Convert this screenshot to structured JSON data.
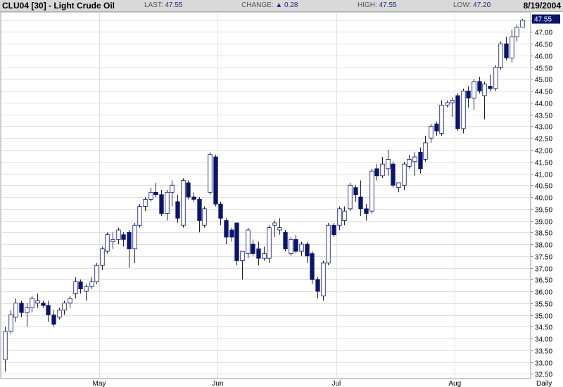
{
  "header": {
    "symbol": "CLU04 [30] - Light Crude Oil",
    "last_label": "LAST:",
    "last_value": "47.55",
    "change_label": "CHANGE:",
    "change_arrow": "▲",
    "change_value": "0.28",
    "high_label": "HIGH:",
    "high_value": "47.55",
    "low_label": "LOW:",
    "low_value": "47.20",
    "date": "8/19/2004"
  },
  "colors": {
    "up_fill": "#ffffff",
    "down_fill": "#0a146e",
    "candle_outline": "#0a146e",
    "grid": "#e0e0e0",
    "header_bg": "#d9d9d9",
    "badge_bg": "#0a146e"
  },
  "chart_data": {
    "type": "candlestick",
    "period_label": "Daily",
    "last_price_label": "47.55",
    "y_ticks": [
      "32.50",
      "33.00",
      "33.50",
      "34.00",
      "34.50",
      "35.00",
      "35.50",
      "36.00",
      "36.50",
      "37.00",
      "37.50",
      "38.00",
      "38.50",
      "39.00",
      "39.50",
      "40.00",
      "40.50",
      "41.00",
      "41.50",
      "42.00",
      "42.50",
      "43.00",
      "43.50",
      "44.00",
      "44.50",
      "45.00",
      "45.50",
      "46.00",
      "46.50",
      "47.00",
      "47.50"
    ],
    "ylim": [
      32.3,
      47.85
    ],
    "x_labels": [
      {
        "label": "May",
        "index": 17.5
      },
      {
        "label": "Jun",
        "index": 39.5
      },
      {
        "label": "Jul",
        "index": 61.5
      },
      {
        "label": "Aug",
        "index": 83.5
      }
    ],
    "x_gridlines": [
      17.5,
      39.5,
      61.5,
      83.5
    ],
    "candles": [
      {
        "o": 33.1,
        "h": 34.5,
        "l": 32.6,
        "c": 34.3
      },
      {
        "o": 34.3,
        "h": 35.2,
        "l": 34.2,
        "c": 35.0
      },
      {
        "o": 34.9,
        "h": 35.7,
        "l": 34.7,
        "c": 35.5
      },
      {
        "o": 35.5,
        "h": 35.6,
        "l": 34.9,
        "c": 35.1
      },
      {
        "o": 35.1,
        "h": 35.5,
        "l": 34.5,
        "c": 35.3
      },
      {
        "o": 35.3,
        "h": 35.8,
        "l": 35.1,
        "c": 35.7
      },
      {
        "o": 35.5,
        "h": 35.9,
        "l": 35.3,
        "c": 35.6
      },
      {
        "o": 35.5,
        "h": 35.6,
        "l": 35.3,
        "c": 35.4
      },
      {
        "o": 35.4,
        "h": 35.6,
        "l": 34.7,
        "c": 35.0
      },
      {
        "o": 35.0,
        "h": 35.2,
        "l": 34.5,
        "c": 34.6
      },
      {
        "o": 34.9,
        "h": 35.3,
        "l": 34.8,
        "c": 35.2
      },
      {
        "o": 35.2,
        "h": 35.6,
        "l": 35.0,
        "c": 35.5
      },
      {
        "o": 35.5,
        "h": 35.8,
        "l": 35.3,
        "c": 35.7
      },
      {
        "o": 35.9,
        "h": 36.6,
        "l": 35.7,
        "c": 36.4
      },
      {
        "o": 36.4,
        "h": 36.5,
        "l": 35.9,
        "c": 36.1
      },
      {
        "o": 36.0,
        "h": 36.3,
        "l": 35.6,
        "c": 36.2
      },
      {
        "o": 36.2,
        "h": 36.6,
        "l": 36.1,
        "c": 36.4
      },
      {
        "o": 36.4,
        "h": 37.2,
        "l": 36.3,
        "c": 37.1
      },
      {
        "o": 37.1,
        "h": 37.9,
        "l": 36.9,
        "c": 37.8
      },
      {
        "o": 37.7,
        "h": 38.5,
        "l": 37.6,
        "c": 38.4
      },
      {
        "o": 38.1,
        "h": 38.5,
        "l": 37.8,
        "c": 38.2
      },
      {
        "o": 38.2,
        "h": 38.7,
        "l": 38.0,
        "c": 38.6
      },
      {
        "o": 38.4,
        "h": 38.5,
        "l": 37.9,
        "c": 38.2
      },
      {
        "o": 38.5,
        "h": 38.6,
        "l": 37.0,
        "c": 37.8
      },
      {
        "o": 37.8,
        "h": 38.9,
        "l": 37.2,
        "c": 38.8
      },
      {
        "o": 38.8,
        "h": 39.7,
        "l": 38.7,
        "c": 39.6
      },
      {
        "o": 39.6,
        "h": 40.0,
        "l": 39.4,
        "c": 39.9
      },
      {
        "o": 39.9,
        "h": 40.4,
        "l": 39.8,
        "c": 40.2
      },
      {
        "o": 40.2,
        "h": 40.6,
        "l": 40.0,
        "c": 40.1
      },
      {
        "o": 40.1,
        "h": 40.3,
        "l": 39.2,
        "c": 39.3
      },
      {
        "o": 39.3,
        "h": 40.3,
        "l": 39.0,
        "c": 40.2
      },
      {
        "o": 40.2,
        "h": 40.7,
        "l": 39.6,
        "c": 40.5
      },
      {
        "o": 39.8,
        "h": 40.1,
        "l": 38.9,
        "c": 39.1
      },
      {
        "o": 38.8,
        "h": 40.8,
        "l": 38.7,
        "c": 40.7
      },
      {
        "o": 40.6,
        "h": 40.7,
        "l": 39.9,
        "c": 40.0
      },
      {
        "o": 40.0,
        "h": 40.2,
        "l": 39.8,
        "c": 39.9
      },
      {
        "o": 39.9,
        "h": 40.0,
        "l": 38.5,
        "c": 39.0
      },
      {
        "o": 38.8,
        "h": 39.6,
        "l": 38.7,
        "c": 39.5
      },
      {
        "o": 40.2,
        "h": 41.9,
        "l": 40.1,
        "c": 41.8
      },
      {
        "o": 41.7,
        "h": 41.8,
        "l": 39.6,
        "c": 39.7
      },
      {
        "o": 39.7,
        "h": 39.8,
        "l": 38.8,
        "c": 39.1
      },
      {
        "o": 39.0,
        "h": 39.1,
        "l": 38.0,
        "c": 38.3
      },
      {
        "o": 38.6,
        "h": 38.7,
        "l": 38.1,
        "c": 38.3
      },
      {
        "o": 38.9,
        "h": 38.9,
        "l": 37.1,
        "c": 37.3
      },
      {
        "o": 37.3,
        "h": 37.5,
        "l": 36.5,
        "c": 37.7
      },
      {
        "o": 37.6,
        "h": 38.7,
        "l": 37.4,
        "c": 38.6
      },
      {
        "o": 38.0,
        "h": 38.2,
        "l": 37.5,
        "c": 37.6
      },
      {
        "o": 37.8,
        "h": 38.1,
        "l": 37.1,
        "c": 37.4
      },
      {
        "o": 37.4,
        "h": 37.9,
        "l": 37.3,
        "c": 37.6
      },
      {
        "o": 37.4,
        "h": 38.8,
        "l": 37.2,
        "c": 38.7
      },
      {
        "o": 38.8,
        "h": 39.0,
        "l": 38.3,
        "c": 38.9
      },
      {
        "o": 38.6,
        "h": 39.1,
        "l": 38.4,
        "c": 38.7
      },
      {
        "o": 38.5,
        "h": 38.6,
        "l": 37.7,
        "c": 37.8
      },
      {
        "o": 37.6,
        "h": 38.3,
        "l": 37.5,
        "c": 38.2
      },
      {
        "o": 38.2,
        "h": 38.4,
        "l": 37.6,
        "c": 37.7
      },
      {
        "o": 37.7,
        "h": 38.1,
        "l": 37.5,
        "c": 38.0
      },
      {
        "o": 38.0,
        "h": 38.1,
        "l": 37.2,
        "c": 37.5
      },
      {
        "o": 37.6,
        "h": 37.7,
        "l": 36.3,
        "c": 36.5
      },
      {
        "o": 36.5,
        "h": 36.6,
        "l": 35.7,
        "c": 36.0
      },
      {
        "o": 35.8,
        "h": 37.3,
        "l": 35.6,
        "c": 37.2
      },
      {
        "o": 37.2,
        "h": 38.9,
        "l": 37.1,
        "c": 38.8
      },
      {
        "o": 38.8,
        "h": 38.9,
        "l": 38.3,
        "c": 38.4
      },
      {
        "o": 38.8,
        "h": 39.6,
        "l": 38.6,
        "c": 39.5
      },
      {
        "o": 39.0,
        "h": 39.6,
        "l": 38.8,
        "c": 39.4
      },
      {
        "o": 39.5,
        "h": 40.6,
        "l": 39.4,
        "c": 40.5
      },
      {
        "o": 40.4,
        "h": 40.5,
        "l": 39.8,
        "c": 40.1
      },
      {
        "o": 40.0,
        "h": 40.7,
        "l": 39.2,
        "c": 39.5
      },
      {
        "o": 39.5,
        "h": 39.7,
        "l": 39.0,
        "c": 39.3
      },
      {
        "o": 39.4,
        "h": 41.2,
        "l": 39.3,
        "c": 41.1
      },
      {
        "o": 41.2,
        "h": 41.4,
        "l": 40.7,
        "c": 40.9
      },
      {
        "o": 40.9,
        "h": 41.7,
        "l": 40.8,
        "c": 41.4
      },
      {
        "o": 41.2,
        "h": 42.0,
        "l": 40.9,
        "c": 41.6
      },
      {
        "o": 41.4,
        "h": 41.5,
        "l": 40.4,
        "c": 40.5
      },
      {
        "o": 40.4,
        "h": 40.6,
        "l": 40.2,
        "c": 40.6
      },
      {
        "o": 40.5,
        "h": 41.5,
        "l": 40.3,
        "c": 41.4
      },
      {
        "o": 41.3,
        "h": 41.8,
        "l": 41.2,
        "c": 41.6
      },
      {
        "o": 41.5,
        "h": 41.9,
        "l": 40.9,
        "c": 41.7
      },
      {
        "o": 41.9,
        "h": 42.1,
        "l": 41.0,
        "c": 41.2
      },
      {
        "o": 41.6,
        "h": 42.6,
        "l": 41.5,
        "c": 42.3
      },
      {
        "o": 42.5,
        "h": 43.1,
        "l": 42.3,
        "c": 43.0
      },
      {
        "o": 43.1,
        "h": 43.2,
        "l": 42.6,
        "c": 42.8
      },
      {
        "o": 42.7,
        "h": 44.1,
        "l": 42.6,
        "c": 43.9
      },
      {
        "o": 43.9,
        "h": 44.1,
        "l": 43.8,
        "c": 44.0
      },
      {
        "o": 44.0,
        "h": 44.2,
        "l": 43.4,
        "c": 44.1
      },
      {
        "o": 44.3,
        "h": 44.4,
        "l": 42.8,
        "c": 42.9
      },
      {
        "o": 42.9,
        "h": 44.6,
        "l": 42.7,
        "c": 44.5
      },
      {
        "o": 44.5,
        "h": 44.7,
        "l": 43.8,
        "c": 44.2
      },
      {
        "o": 44.2,
        "h": 45.0,
        "l": 43.7,
        "c": 44.9
      },
      {
        "o": 44.9,
        "h": 45.1,
        "l": 44.4,
        "c": 44.5
      },
      {
        "o": 44.3,
        "h": 44.9,
        "l": 43.3,
        "c": 44.8
      },
      {
        "o": 44.7,
        "h": 45.2,
        "l": 44.5,
        "c": 44.6
      },
      {
        "o": 44.6,
        "h": 45.6,
        "l": 44.5,
        "c": 45.5
      },
      {
        "o": 45.5,
        "h": 46.6,
        "l": 45.4,
        "c": 46.5
      },
      {
        "o": 46.5,
        "h": 46.8,
        "l": 45.8,
        "c": 45.9
      },
      {
        "o": 45.9,
        "h": 47.1,
        "l": 45.7,
        "c": 46.8
      },
      {
        "o": 46.8,
        "h": 47.3,
        "l": 46.6,
        "c": 47.2
      },
      {
        "o": 47.2,
        "h": 47.55,
        "l": 47.2,
        "c": 47.5
      }
    ]
  }
}
